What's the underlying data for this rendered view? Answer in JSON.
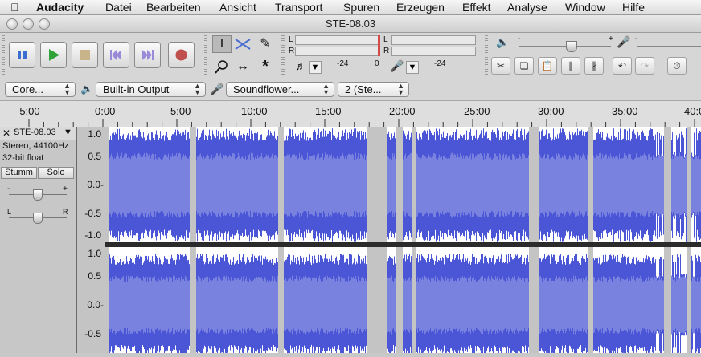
{
  "menubar": {
    "apple": "",
    "items": [
      "Audacity",
      "Datei",
      "Bearbeiten",
      "Ansicht",
      "Transport",
      "Spuren",
      "Erzeugen",
      "Effekt",
      "Analyse",
      "Window",
      "Hilfe"
    ]
  },
  "window": {
    "title": "STE-08.03"
  },
  "transport": {
    "buttons": [
      "pause",
      "play",
      "stop",
      "skip-to-start",
      "skip-to-end",
      "record"
    ]
  },
  "tools": {
    "items": [
      "selection-tool",
      "envelope-tool",
      "draw-tool",
      "zoom-tool",
      "timeshift-tool",
      "multi-tool"
    ]
  },
  "meters": {
    "rec_l": "L",
    "rec_r": "R",
    "play_l": "L",
    "play_r": "R",
    "scale": [
      "-24",
      "0",
      "-24"
    ]
  },
  "mixer": {
    "minus": "-",
    "plus": "+"
  },
  "devices": {
    "host": "Core...",
    "output": "Built-in Output",
    "input": "Soundflower...",
    "channels": "2 (Ste..."
  },
  "ruler": {
    "labels": [
      "-5:00",
      "0:00",
      "5:00",
      "10:00",
      "15:00",
      "20:00",
      "25:00",
      "30:00",
      "35:00",
      "40:0"
    ]
  },
  "track": {
    "name": "STE-08.03",
    "info1": "Stereo, 44100Hz",
    "info2": "32-bit float",
    "mute": "Stumm",
    "solo": "Solo",
    "gain_minus": "-",
    "gain_plus": "+",
    "pan_l": "L",
    "pan_r": "R",
    "close": "✕",
    "menu_arrow": "▼"
  },
  "vruler": {
    "labels": [
      "1.0",
      "0.5",
      "0.0-",
      "-0.5",
      "-1.0",
      "1.0",
      "0.5",
      "0.0-",
      "-0.5"
    ]
  },
  "colors": {
    "wave_dark": "#4b56d6",
    "wave_light": "#7a82e0",
    "gap": "#c4c4c4"
  }
}
